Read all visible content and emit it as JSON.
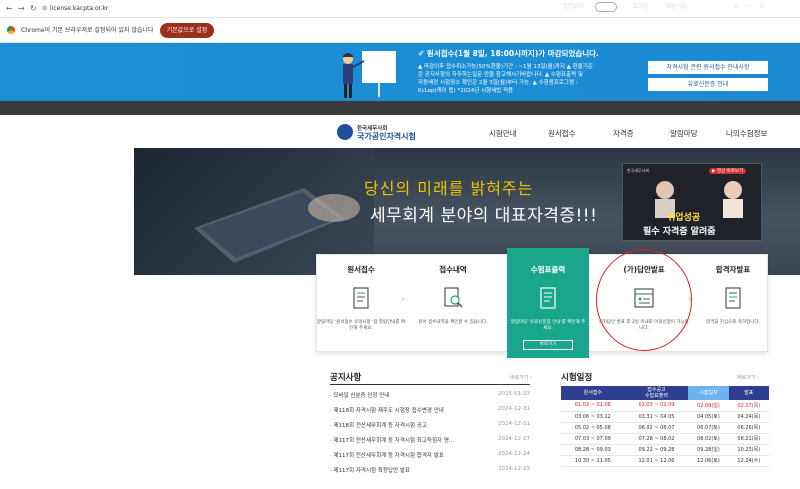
{
  "browser": {
    "url": "license.kacpta.or.kr",
    "info_message": "Chrome이 기본 브라우저로 설정되어 있지 않습니다",
    "default_button": "기본값으로 설정"
  },
  "banner": {
    "title": "원서접수(1월 8일, 18:00시까지)가 마감되었습니다.",
    "lines": [
      "▲ 마감이후 접수취소가능(50%환불)기간 : ~1월 13일(월)까지 ▲ 환불기준",
      "은 공지사항의 자주하는질문 란을 참고해시기바랍니다. ▲ 수험표출력 및",
      "자동배정 시험장소 확인은 2월 3일(월)부터 가능. ▲ 수험용프로그램 :",
      "KcLep(케이 렙) *2024년 시행세법 적용"
    ],
    "btn1": "자격시험 관련 원서접수 안내사항",
    "btn2": "유료신문증 안내"
  },
  "topbar": {
    "items": [
      "합법보기",
      "알림",
      "로그인",
      "회원가입",
      "화면크기"
    ],
    "zoom": [
      "+",
      "−",
      "0"
    ]
  },
  "logo": {
    "line1": "한국세무사회",
    "line2": "국가공인자격시험"
  },
  "gnb": [
    "시험안내",
    "원서접수",
    "자격증",
    "알림마당",
    "나의수험정보"
  ],
  "hero": {
    "line1": "당신의 미래를 밝혀주는",
    "line2": "세무회계 분야의 대표자격증!!!",
    "video_tag": "영상 바로보기",
    "video_channel": "한국세무사회",
    "video_line1": "취업성공",
    "video_line2": "필수 자격증 알려줌"
  },
  "cards": [
    {
      "title": "원서접수",
      "desc": "알림마당 '원서접수 유의사항' 참 열람안내를 확인해 주세요."
    },
    {
      "title": "접수내역",
      "desc": "원서 접수내역을 확인할 수 있습니다."
    },
    {
      "title": "수험표출력",
      "desc": "알림마당 '유료신문증 안내'를 확인해 주세요.",
      "button": "바로가기"
    },
    {
      "title": "(가)답안발표",
      "desc": "(가)답안 발표 후 3일 이내로 이의신청이 가능합니다."
    },
    {
      "title": "합격자발표",
      "desc": "합격을 진심으로 축하합니다."
    }
  ],
  "notice": {
    "title": "공지사항",
    "more": "바로가기 ›",
    "items": [
      {
        "title": "모바일 신분증 인정 안내",
        "date": "2025-01-23"
      },
      {
        "title": "제118회 자격시험 제주도 시험장 접수변경 안내",
        "date": "2024-12-31"
      },
      {
        "title": "제118회 전산세무회계 등 자격시험 공고",
        "date": "2024-12-31"
      },
      {
        "title": "제117회 전산세무회계 등 자격시험 최고득점자 명...",
        "date": "2024-12-27"
      },
      {
        "title": "제117회 전산세무회계 등 자격시험 합격자 발표",
        "date": "2024-12-24"
      },
      {
        "title": "제117회 자격시험 확정답안 발표",
        "date": "2024-12-23"
      }
    ]
  },
  "schedule": {
    "title": "시험일정",
    "more": "바로가기 ›",
    "headers": [
      "원서접수",
      "접수공고\n수험표출력",
      "시험일자",
      "발표"
    ],
    "header_colors": [
      "#2f3f8f",
      "#2f3f8f",
      "#6bb4f0",
      "#2f3f8f"
    ],
    "rows": [
      [
        "01.02 ~ 01.08",
        "02.03 ~ 02.09",
        "02.09(일)",
        "02.27(목)"
      ],
      [
        "03.06 ~ 03.12",
        "03.31 ~ 04.05",
        "04.05(토)",
        "04.24(목)"
      ],
      [
        "05.02 ~ 05.08",
        "06.02 ~ 06.07",
        "06.07(토)",
        "06.26(목)"
      ],
      [
        "07.03 ~ 07.09",
        "07.28 ~ 08.02",
        "08.02(토)",
        "08.21(목)"
      ],
      [
        "08.28 ~ 09.03",
        "09.22 ~ 09.28",
        "09.28(일)",
        "10.23(목)"
      ],
      [
        "10.30 ~ 11.05",
        "12.01 ~ 12.06",
        "12.06(토)",
        "12.24(수)"
      ]
    ]
  }
}
